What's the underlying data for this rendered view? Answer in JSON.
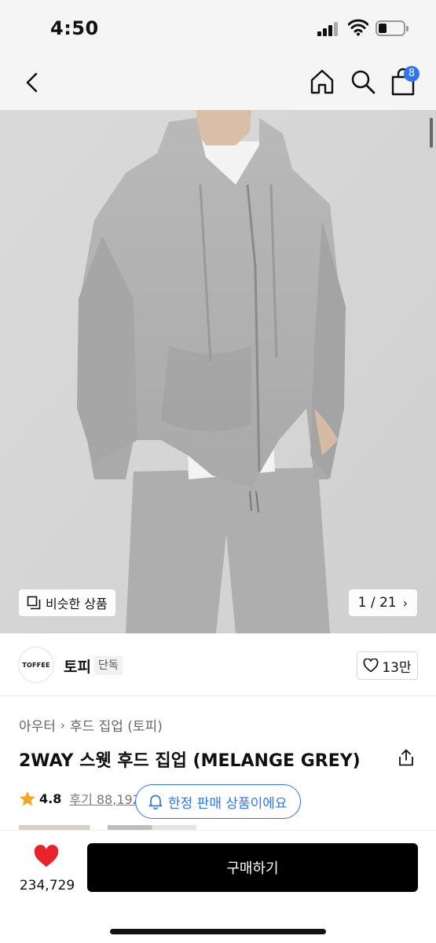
{
  "status_bar": {
    "time": "4:50"
  },
  "nav": {
    "cart_count": "8"
  },
  "gallery": {
    "similar_label": "비슷한 상품",
    "page_counter": "1 / 21"
  },
  "brand": {
    "logo_text": "TOFFEE",
    "name": "토피",
    "tag": "단독",
    "likes": "13만"
  },
  "product": {
    "breadcrumb": [
      "아우터",
      "후드 집업 (토피)"
    ],
    "title": "2WAY 스웻 후드 집업 (MELANGE GREY)",
    "rating": "4.8",
    "reviews": "후기 88,192",
    "notice": "한정 판매 상품이에요"
  },
  "bottom_bar": {
    "wish_count": "234,729",
    "buy_label": "구매하기"
  },
  "colors": {
    "accent": "#2f74f5",
    "heart": "#e8232c",
    "star": "#f5a623",
    "buy_bg": "#000000"
  }
}
